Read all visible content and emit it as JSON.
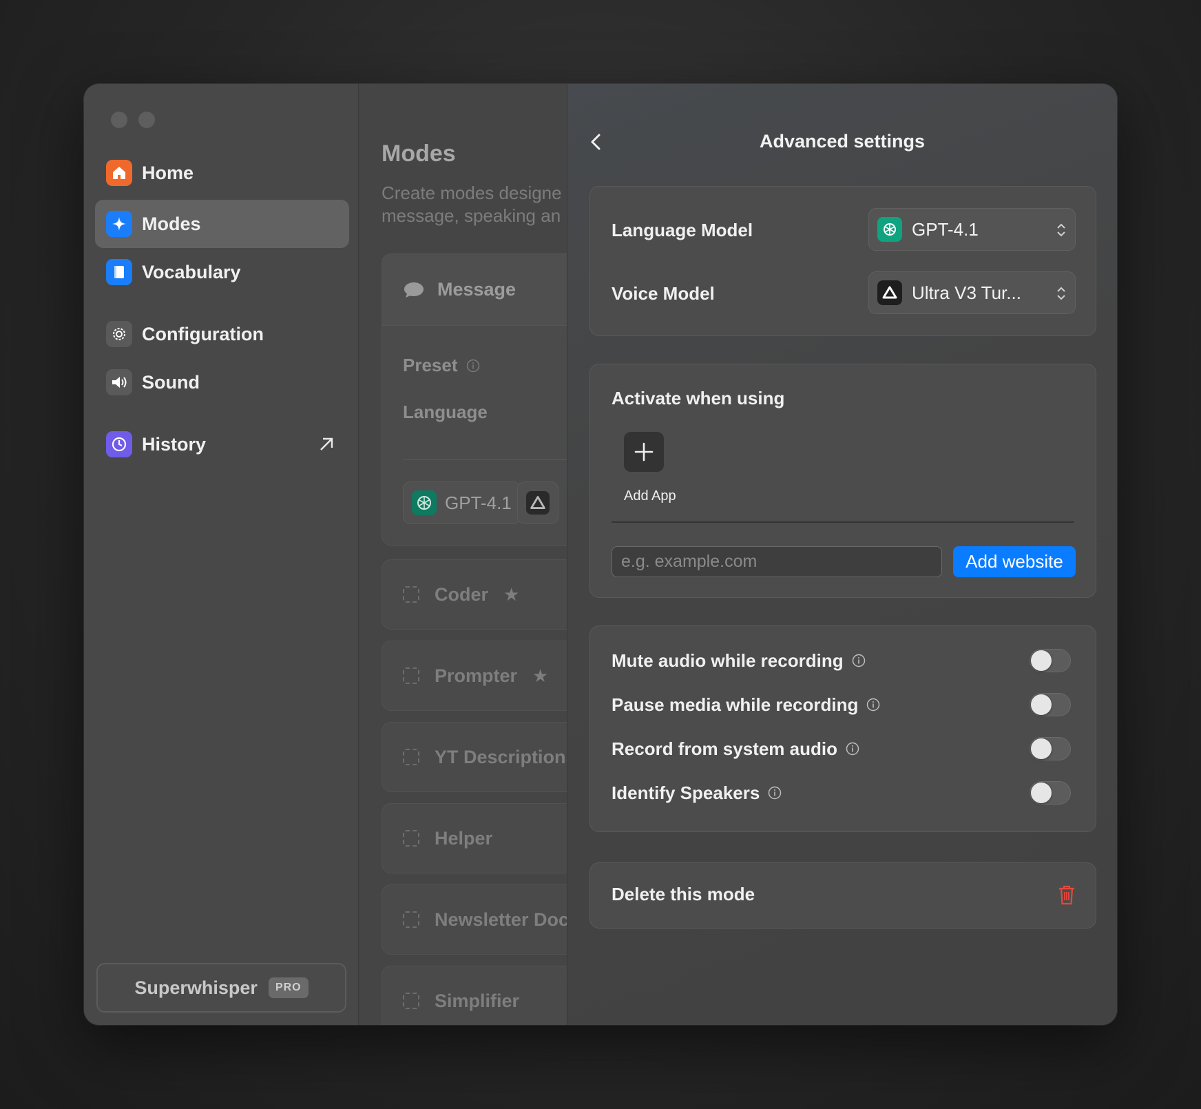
{
  "sidebar": {
    "items": [
      {
        "label": "Home",
        "icon": "house-icon",
        "color": "#f0692c"
      },
      {
        "label": "Modes",
        "icon": "sparkle-icon",
        "color": "#1a7dfa"
      },
      {
        "label": "Vocabulary",
        "icon": "book-icon",
        "color": "#1a7dfa"
      },
      {
        "label": "Configuration",
        "icon": "gear-icon",
        "color": "#5a5a5a"
      },
      {
        "label": "Sound",
        "icon": "speaker-icon",
        "color": "#5a5a5a"
      },
      {
        "label": "History",
        "icon": "history-icon",
        "color": "#6f5ce8"
      }
    ],
    "active": "Modes",
    "app_name": "Superwhisper",
    "badge": "PRO"
  },
  "modes_list": {
    "title": "Modes",
    "description_line1": "Create modes designe",
    "description_line2": "message, speaking an",
    "message_card": {
      "title": "Message",
      "preset_label": "Preset",
      "language_label": "Language",
      "model_chip": "GPT-4.1"
    },
    "modes": [
      {
        "name": "Coder",
        "starred": true
      },
      {
        "name": "Prompter",
        "starred": true
      },
      {
        "name": "YT Descriptions",
        "starred": false
      },
      {
        "name": "Helper",
        "starred": false
      },
      {
        "name": "Newsletter Doc",
        "starred": false
      },
      {
        "name": "Simplifier",
        "starred": false
      }
    ]
  },
  "advanced": {
    "title": "Advanced settings",
    "models": {
      "language_model_label": "Language Model",
      "language_model_value": "GPT-4.1",
      "voice_model_label": "Voice Model",
      "voice_model_value": "Ultra V3 Tur..."
    },
    "activate": {
      "title": "Activate when using",
      "add_app_label": "Add App",
      "website_placeholder": "e.g. example.com",
      "add_website_label": "Add website"
    },
    "toggles": [
      {
        "label": "Mute audio while recording",
        "on": false
      },
      {
        "label": "Pause media while recording",
        "on": false
      },
      {
        "label": "Record from system audio",
        "on": false
      },
      {
        "label": "Identify Speakers",
        "on": false
      }
    ],
    "delete_label": "Delete this mode"
  },
  "colors": {
    "accent": "#0a7cff",
    "openai_green": "#10a37f",
    "delete_red": "#e5483d"
  }
}
